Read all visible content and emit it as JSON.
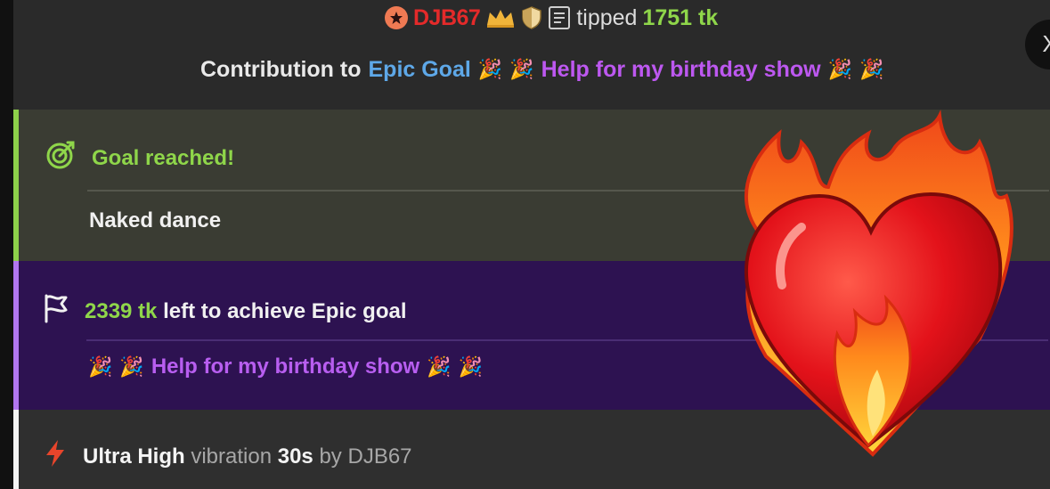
{
  "tip": {
    "username": "DJB67",
    "tipped_label": "tipped",
    "amount": "1751 tk"
  },
  "contribution": {
    "label": "Contribution to",
    "goal_link": "Epic Goal",
    "goal_name": "Help for my birthday show",
    "emoji": "🎉"
  },
  "close_button": {
    "label": "X"
  },
  "goal_reached": {
    "title": "Goal reached!",
    "item": "Naked dance"
  },
  "epic_goal": {
    "amount": "2339 tk",
    "text": "left to achieve Epic goal",
    "name": "Help for my birthday show",
    "emoji": "🎉"
  },
  "vibration": {
    "level": "Ultra High",
    "type": "vibration",
    "duration": "30s",
    "by_label": "by",
    "user": "DJB67"
  },
  "colors": {
    "accent_green": "#8fd64a",
    "accent_purple": "#bd58f0",
    "link_blue": "#5ea8e8",
    "username_red": "#e42a2a"
  },
  "icons": [
    "star-badge-icon",
    "crown-icon",
    "shield-icon",
    "document-icon",
    "party-popper-icon",
    "target-icon",
    "flag-icon",
    "lightning-icon",
    "close-icon",
    "flaming-heart-sticker"
  ]
}
